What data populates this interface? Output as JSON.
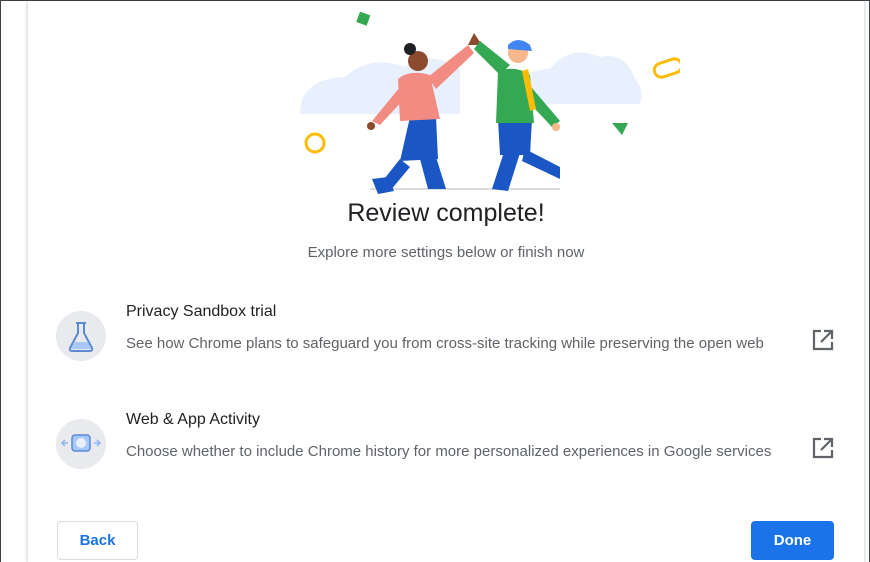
{
  "title": "Review complete!",
  "subtitle": "Explore more settings below or finish now",
  "items": [
    {
      "title": "Privacy Sandbox trial",
      "description": "See how Chrome plans to safeguard you from cross-site tracking while preserving the open web",
      "icon": "flask-icon",
      "link_icon": "open-in-new-icon"
    },
    {
      "title": "Web & App Activity",
      "description": "Choose whether to include Chrome history for more personalized experiences in Google services",
      "icon": "web-activity-icon",
      "link_icon": "open-in-new-icon"
    }
  ],
  "buttons": {
    "back": "Back",
    "done": "Done"
  },
  "colors": {
    "accent": "#1a73e8",
    "text_primary": "#202124",
    "text_secondary": "#5f6368",
    "icon_circle": "#e8eaed"
  }
}
